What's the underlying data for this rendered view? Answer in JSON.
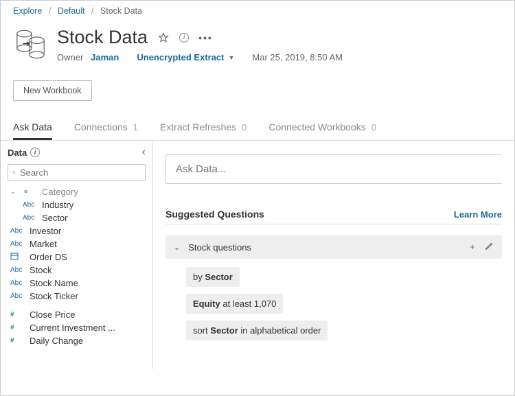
{
  "breadcrumb": {
    "root": "Explore",
    "project": "Default",
    "current": "Stock Data"
  },
  "header": {
    "title": "Stock Data",
    "owner_label": "Owner",
    "owner_name": "Jaman",
    "extract_type": "Unencrypted Extract",
    "timestamp": "Mar 25, 2019, 8:50 AM"
  },
  "actions": {
    "new_workbook": "New Workbook"
  },
  "tabs": [
    {
      "label": "Ask Data",
      "count": "",
      "active": true
    },
    {
      "label": "Connections",
      "count": "1",
      "active": false
    },
    {
      "label": "Extract Refreshes",
      "count": "0",
      "active": false
    },
    {
      "label": "Connected Workbooks",
      "count": "0",
      "active": false
    }
  ],
  "sidebar": {
    "title": "Data",
    "search_placeholder": "Search",
    "category_label": "Category",
    "fields_dimensions": [
      {
        "label": "Industry",
        "type": "Abc",
        "indent": true
      },
      {
        "label": "Sector",
        "type": "Abc",
        "indent": true
      },
      {
        "label": "Investor",
        "type": "Abc",
        "indent": false
      },
      {
        "label": "Market",
        "type": "Abc",
        "indent": false
      },
      {
        "label": "Order DS",
        "type": "date",
        "indent": false
      },
      {
        "label": "Stock",
        "type": "Abc",
        "indent": false
      },
      {
        "label": "Stock Name",
        "type": "Abc",
        "indent": false
      },
      {
        "label": "Stock Ticker",
        "type": "Abc",
        "indent": false
      }
    ],
    "fields_measures": [
      {
        "label": "Close Price"
      },
      {
        "label": "Current Investment ..."
      },
      {
        "label": "Daily Change"
      }
    ]
  },
  "askdata": {
    "placeholder": "Ask Data...",
    "suggested_title": "Suggested Questions",
    "learn_more": "Learn More",
    "group": "Stock questions",
    "chips": {
      "c1_pre": "by ",
      "c1_b": "Sector",
      "c2_b": "Equity",
      "c2_post": " at least 1,070",
      "c3_pre": "sort ",
      "c3_b": "Sector",
      "c3_post": " in alphabetical order"
    }
  }
}
